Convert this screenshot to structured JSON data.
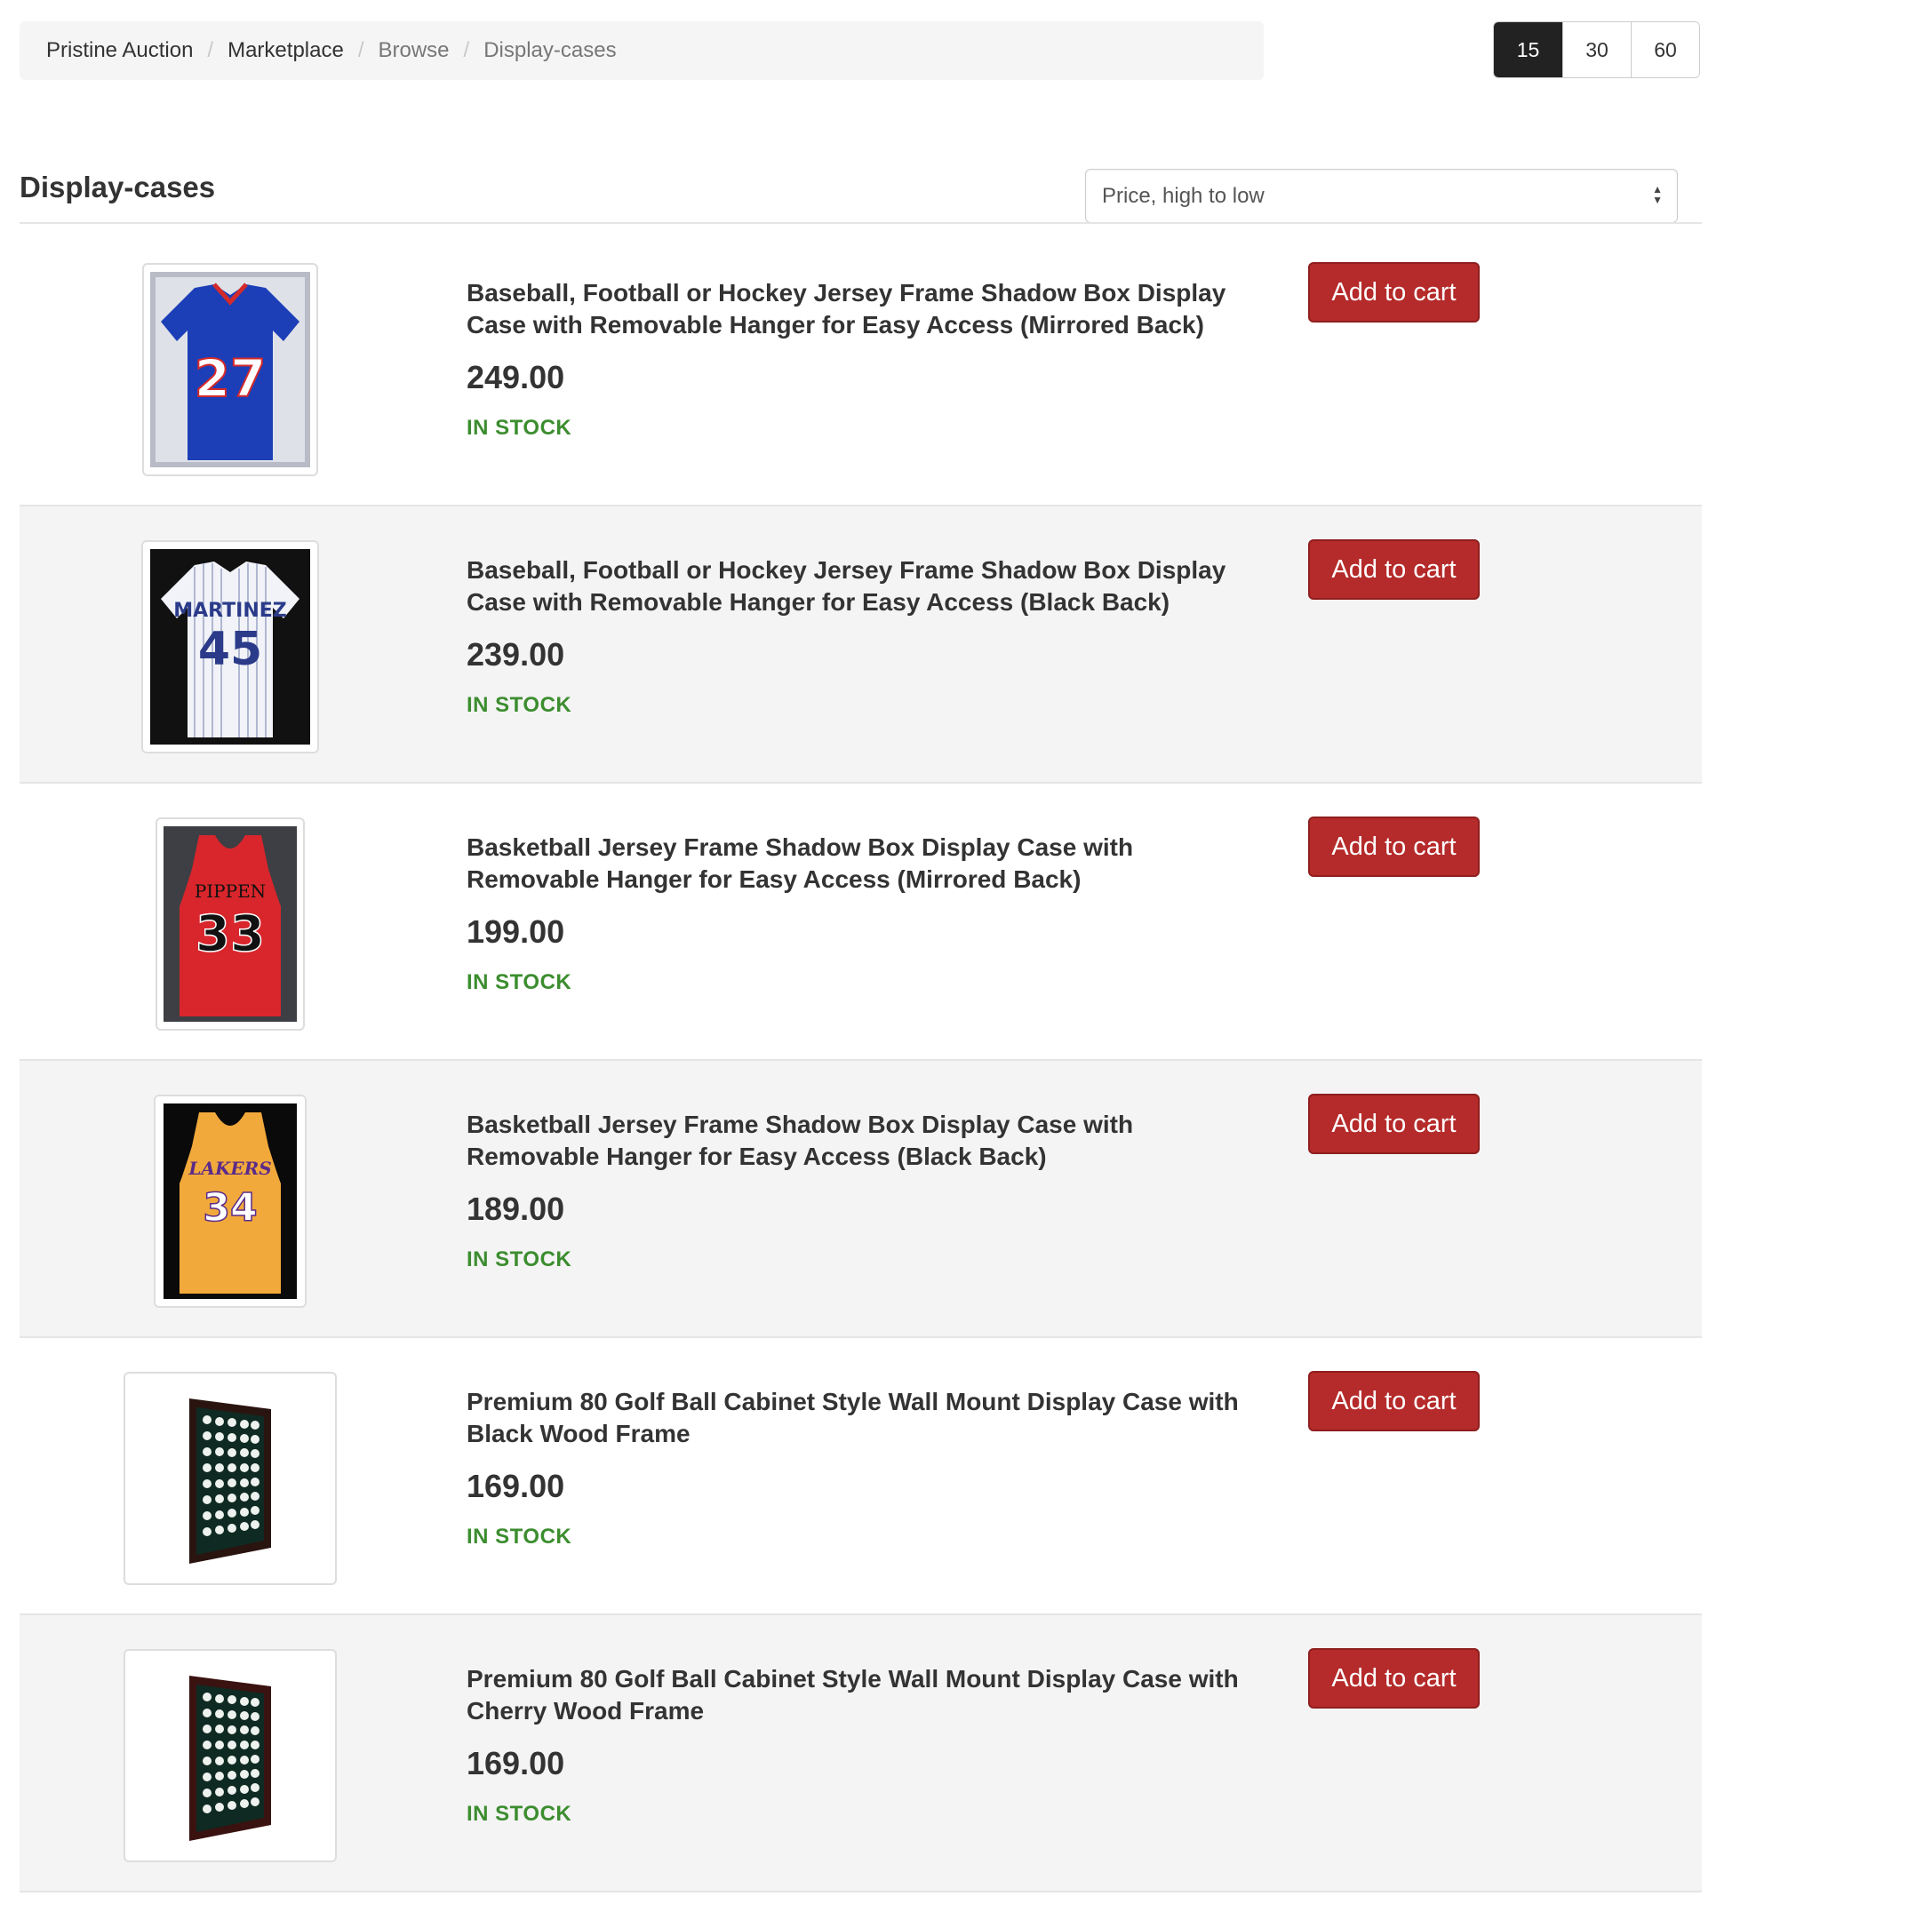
{
  "breadcrumb": {
    "items": [
      "Pristine Auction",
      "Marketplace",
      "Browse",
      "Display-cases"
    ]
  },
  "per_page": {
    "options": [
      "15",
      "30",
      "60"
    ],
    "selected": "15"
  },
  "category": {
    "title": "Display-cases",
    "sort_value": "Price, high to low"
  },
  "products": [
    {
      "name": "Baseball, Football or Hockey Jersey Frame Shadow Box Display Case with Removable Hanger for Easy Access (Mirrored Back)",
      "price": "249.00",
      "stock": "IN STOCK",
      "cart_label": "Add to cart",
      "image_icon": "blue-jersey-27-icon"
    },
    {
      "name": "Baseball, Football or Hockey Jersey Frame Shadow Box Display Case with Removable Hanger for Easy Access (Black Back)",
      "price": "239.00",
      "stock": "IN STOCK",
      "cart_label": "Add to cart",
      "image_icon": "pinstripe-jersey-45-icon"
    },
    {
      "name": "Basketball Jersey Frame Shadow Box Display Case with Removable Hanger for Easy Access (Mirrored Back)",
      "price": "199.00",
      "stock": "IN STOCK",
      "cart_label": "Add to cart",
      "image_icon": "red-jersey-33-icon"
    },
    {
      "name": "Basketball Jersey Frame Shadow Box Display Case with Removable Hanger for Easy Access (Black Back)",
      "price": "189.00",
      "stock": "IN STOCK",
      "cart_label": "Add to cart",
      "image_icon": "gold-jersey-34-icon"
    },
    {
      "name": "Premium 80 Golf Ball Cabinet Style Wall Mount Display Case with Black Wood Frame",
      "price": "169.00",
      "stock": "IN STOCK",
      "cart_label": "Add to cart",
      "image_icon": "golf-ball-cabinet-icon"
    },
    {
      "name": "Premium 80 Golf Ball Cabinet Style Wall Mount Display Case with Cherry Wood Frame",
      "price": "169.00",
      "stock": "IN STOCK",
      "cart_label": "Add to cart",
      "image_icon": "golf-ball-cabinet-icon"
    }
  ],
  "colors": {
    "accent_button": "#b52a2a",
    "in_stock": "#3c8d2f",
    "active_toggle": "#222222"
  }
}
